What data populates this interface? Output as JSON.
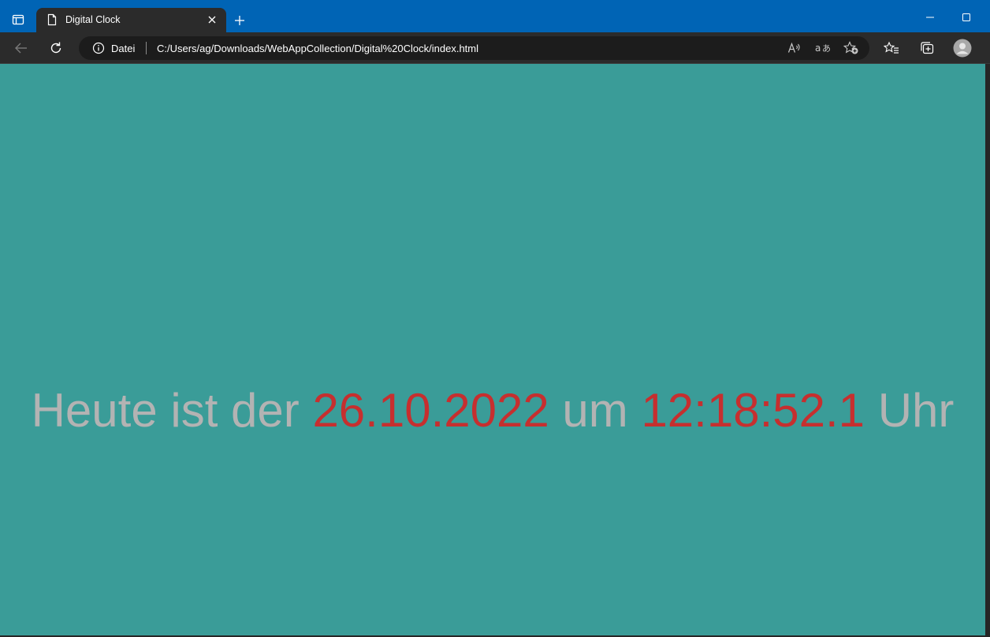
{
  "browser": {
    "tab": {
      "title": "Digital Clock"
    },
    "address": {
      "protocol_label": "Datei",
      "url": "C:/Users/ag/Downloads/WebAppCollection/Digital%20Clock/index.html"
    }
  },
  "page": {
    "clock": {
      "prefix": "Heute ist der",
      "date": "26.10.2022",
      "connector": "um",
      "time": "12:18:52.1",
      "suffix": "Uhr"
    }
  },
  "colors": {
    "titlebar": "#0064b5",
    "page_background": "#3a9c98",
    "text_muted": "#b3b3b3",
    "text_accent": "#c62f2f"
  },
  "icons": {
    "tab_actions": "tab-actions-icon",
    "favicon": "page-icon",
    "close": "close-icon",
    "new_tab": "plus-icon",
    "minimize": "minimize-icon",
    "maximize": "maximize-icon",
    "back": "back-arrow-icon",
    "refresh": "refresh-icon",
    "info": "info-icon",
    "read_aloud": "read-aloud-icon",
    "translate": "translate-icon",
    "add_favorite": "add-favorite-icon",
    "favorites": "favorites-icon",
    "collections": "collections-icon",
    "profile": "profile-avatar-icon"
  }
}
